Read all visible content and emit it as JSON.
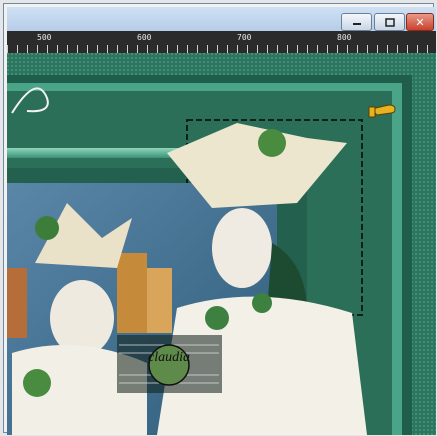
{
  "window": {
    "controls": {
      "minimize_icon": "minimize-icon",
      "maximize_icon": "maximize-icon",
      "close_icon": "close-icon",
      "close_glyph": "✕"
    }
  },
  "ruler": {
    "labels": [
      "500",
      "600",
      "700",
      "800"
    ]
  },
  "canvas": {
    "watermark_text": "claudia",
    "colors": {
      "frame_dark": "#1f5e4a",
      "frame_mid": "#3f9a7d",
      "frame_light": "#8fd1b6",
      "accent": "#e8b320"
    },
    "cursor_icon": "pointing-hand-icon",
    "image_description_icon": "venetian-masks-photo"
  }
}
